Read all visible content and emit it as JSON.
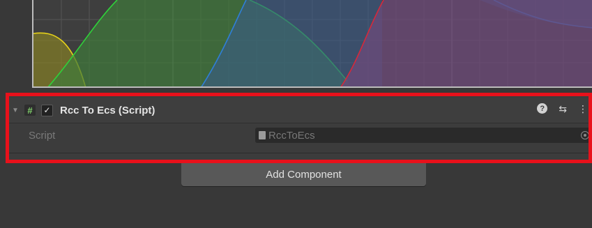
{
  "component": {
    "title": "Rcc To Ecs (Script)",
    "enabled_mark": "✓",
    "script_icon_glyph": "#",
    "foldout_glyph": "▼",
    "help_glyph": "?",
    "presets_glyph": "⇆",
    "menu_glyph": "⋮",
    "properties": [
      {
        "label": "Script",
        "value": "RccToEcs"
      }
    ]
  },
  "add_component_label": "Add Component",
  "colors": {
    "highlight": "#e8111b",
    "curve_yellow": "#e6d21a",
    "curve_green": "#2fd23a",
    "curve_blue": "#2f7fd8",
    "curve_red": "#d8283a"
  }
}
